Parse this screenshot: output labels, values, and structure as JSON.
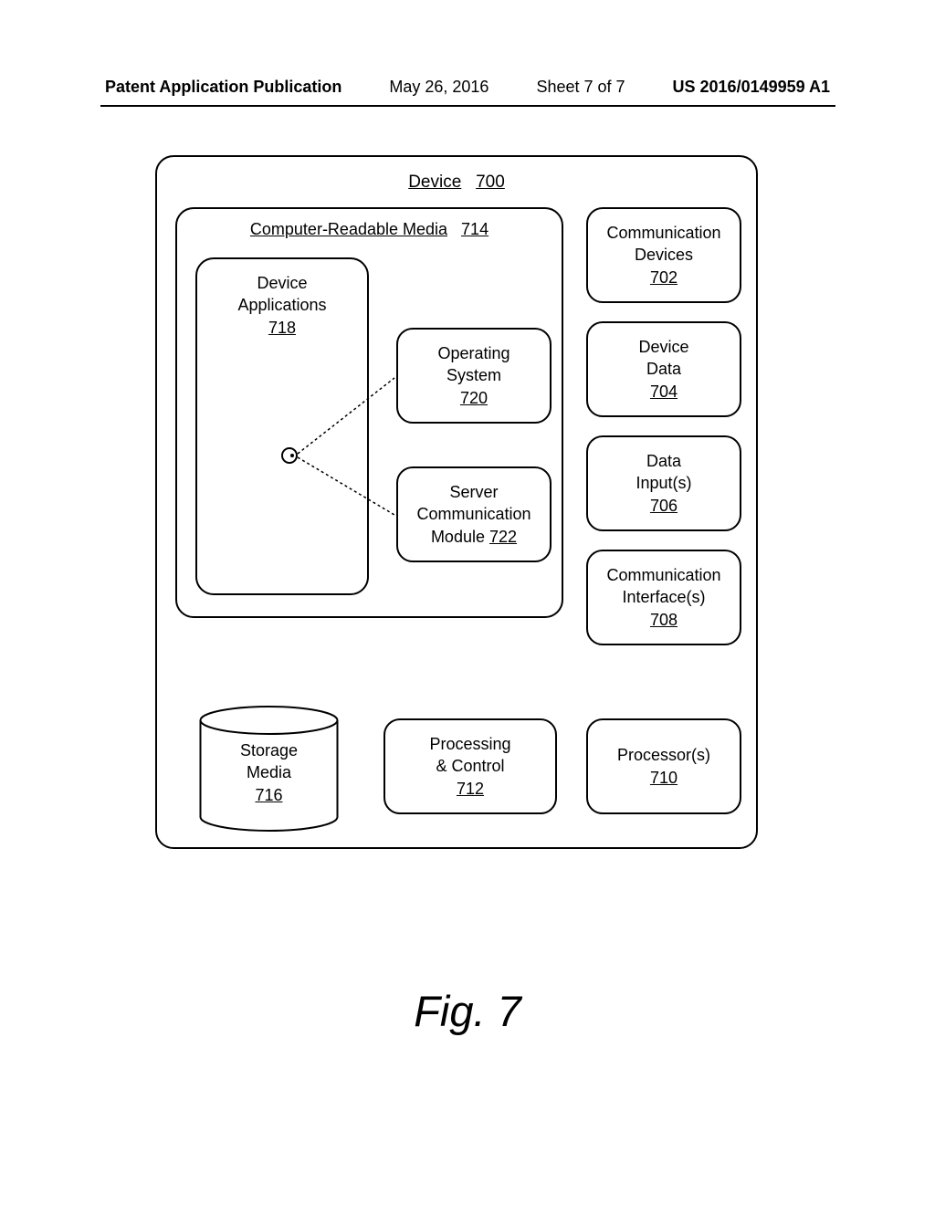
{
  "header": {
    "publication_label": "Patent Application Publication",
    "date": "May 26, 2016",
    "sheet": "Sheet 7 of 7",
    "pubnum": "US 2016/0149959 A1"
  },
  "figure_label": "Fig. 7",
  "device": {
    "title_text": "Device",
    "title_ref": "700",
    "media": {
      "title_text": "Computer-Readable Media",
      "title_ref": "714",
      "apps": {
        "line1": "Device",
        "line2": "Applications",
        "ref": "718"
      },
      "os": {
        "line1": "Operating",
        "line2": "System",
        "ref": "720"
      },
      "module": {
        "line1": "Server",
        "line2": "Communication",
        "line3_text": "Module",
        "ref": "722"
      }
    },
    "side": {
      "comm_dev": {
        "line1": "Communication",
        "line2": "Devices",
        "ref": "702"
      },
      "dev_data": {
        "line1": "Device",
        "line2": "Data",
        "ref": "704"
      },
      "data_inputs": {
        "line1": "Data",
        "line2": "Input(s)",
        "ref": "706"
      },
      "comm_int": {
        "line1": "Communication",
        "line2": "Interface(s)",
        "ref": "708"
      },
      "processors": {
        "line1": "Processor(s)",
        "ref": "710"
      }
    },
    "bottom": {
      "proc_ctrl": {
        "line1": "Processing",
        "line2": "& Control",
        "ref": "712"
      },
      "storage": {
        "line1": "Storage",
        "line2": "Media",
        "ref": "716"
      }
    }
  }
}
